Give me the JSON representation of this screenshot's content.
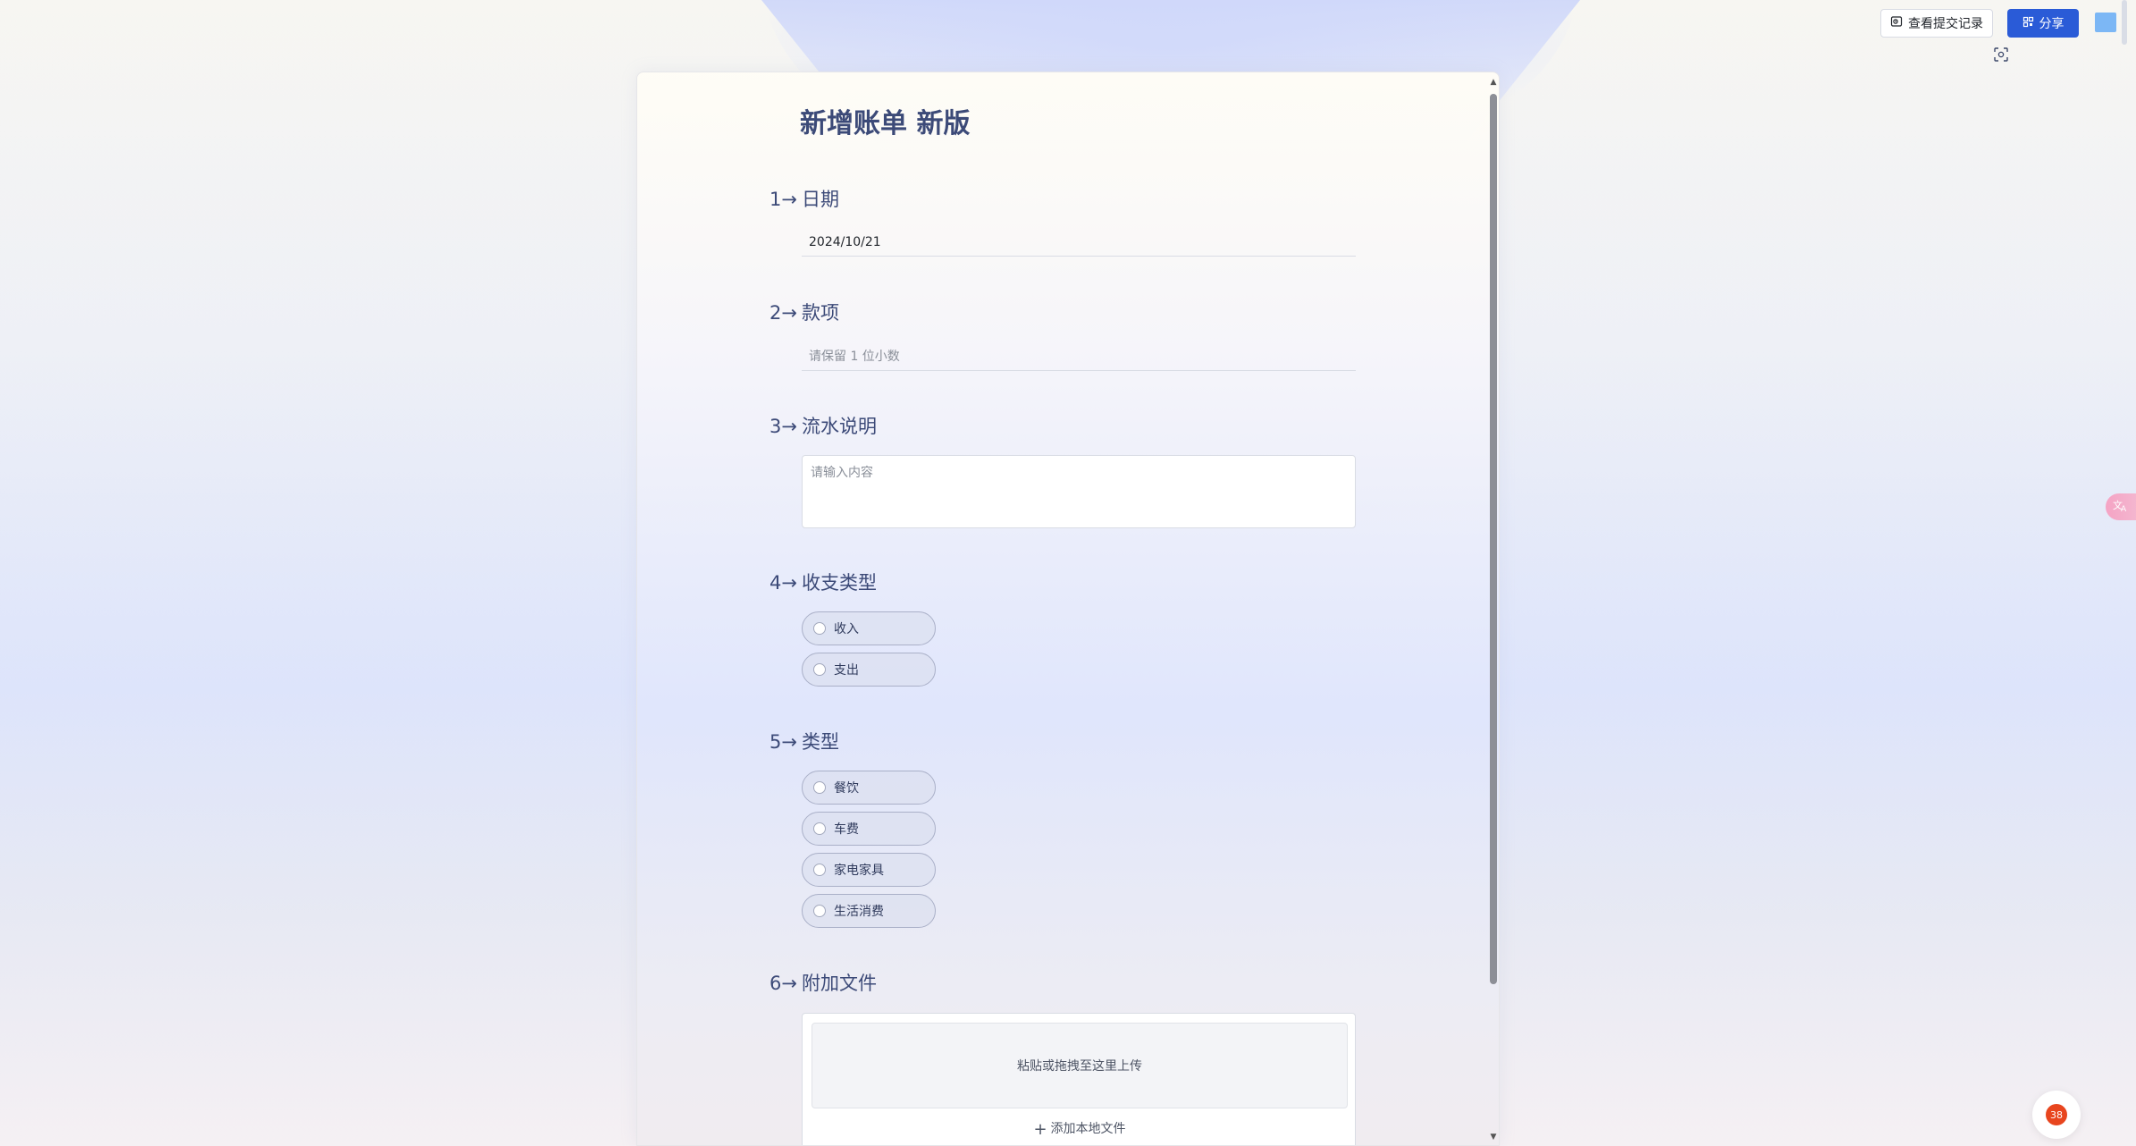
{
  "toolbar": {
    "history_label": "查看提交记录",
    "share_label": "分享",
    "notification_count": "38",
    "accent_color": "#2a5bd7"
  },
  "form": {
    "title": "新增账单 新版",
    "questions": [
      {
        "number": "1→",
        "title": "日期",
        "value": "2024/10/21"
      },
      {
        "number": "2→",
        "title": "款项",
        "placeholder": "请保留 1 位小数"
      },
      {
        "number": "3→",
        "title": "流水说明",
        "placeholder": "请输入内容"
      },
      {
        "number": "4→",
        "title": "收支类型",
        "options": [
          "收入",
          "支出"
        ]
      },
      {
        "number": "5→",
        "title": "类型",
        "options": [
          "餐饮",
          "车费",
          "家电家具",
          "生活消费"
        ]
      },
      {
        "number": "6→",
        "title": "附加文件",
        "dropzone_text": "粘贴或拖拽至这里上传",
        "add_file_label": "添加本地文件"
      }
    ]
  },
  "icons": {
    "history": "history-icon",
    "share": "share-icon",
    "scan": "scan-icon",
    "translate": "translate-icon",
    "plus": "plus-icon"
  }
}
